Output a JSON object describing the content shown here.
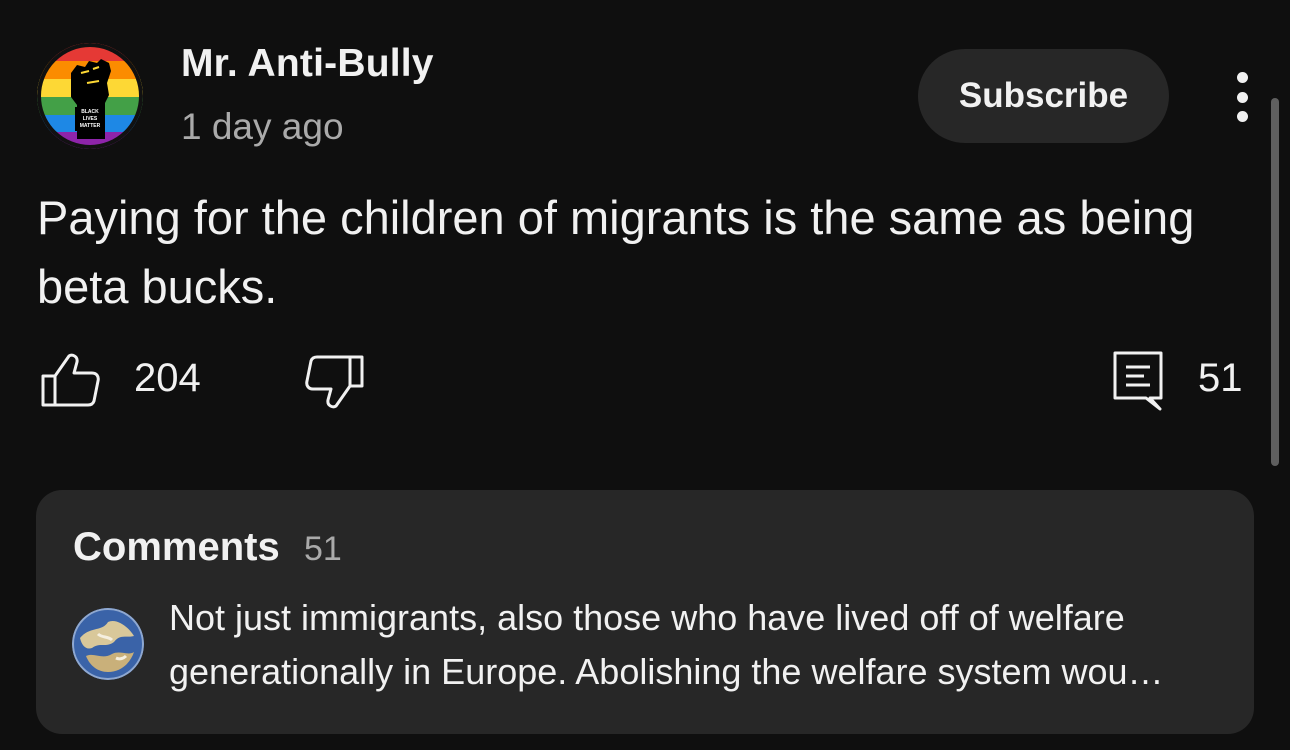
{
  "post": {
    "channel_name": "Mr. Anti-Bully",
    "time_ago": "1 day ago",
    "subscribe_label": "Subscribe",
    "text": "Paying for the children of migrants is the same as being beta bucks.",
    "avatar_badge_text": "BLACK LIVES MATTER",
    "like_count": "204",
    "comment_count": "51"
  },
  "comments": {
    "heading": "Comments",
    "count": "51",
    "top_comment": {
      "text": "Not just immigrants, also those who have lived off of welfare generationally in Europe. Abolishing the welfare system wou…"
    }
  },
  "icons": {
    "avatar": "raised-fist-rainbow-icon",
    "like": "thumbs-up-icon",
    "dislike": "thumbs-down-icon",
    "comments": "comment-icon",
    "more": "more-vertical-icon"
  },
  "colors": {
    "background": "#0f0f0f",
    "card": "#272727",
    "text_primary": "#f1f1f1",
    "text_secondary": "#aaaaaa"
  }
}
